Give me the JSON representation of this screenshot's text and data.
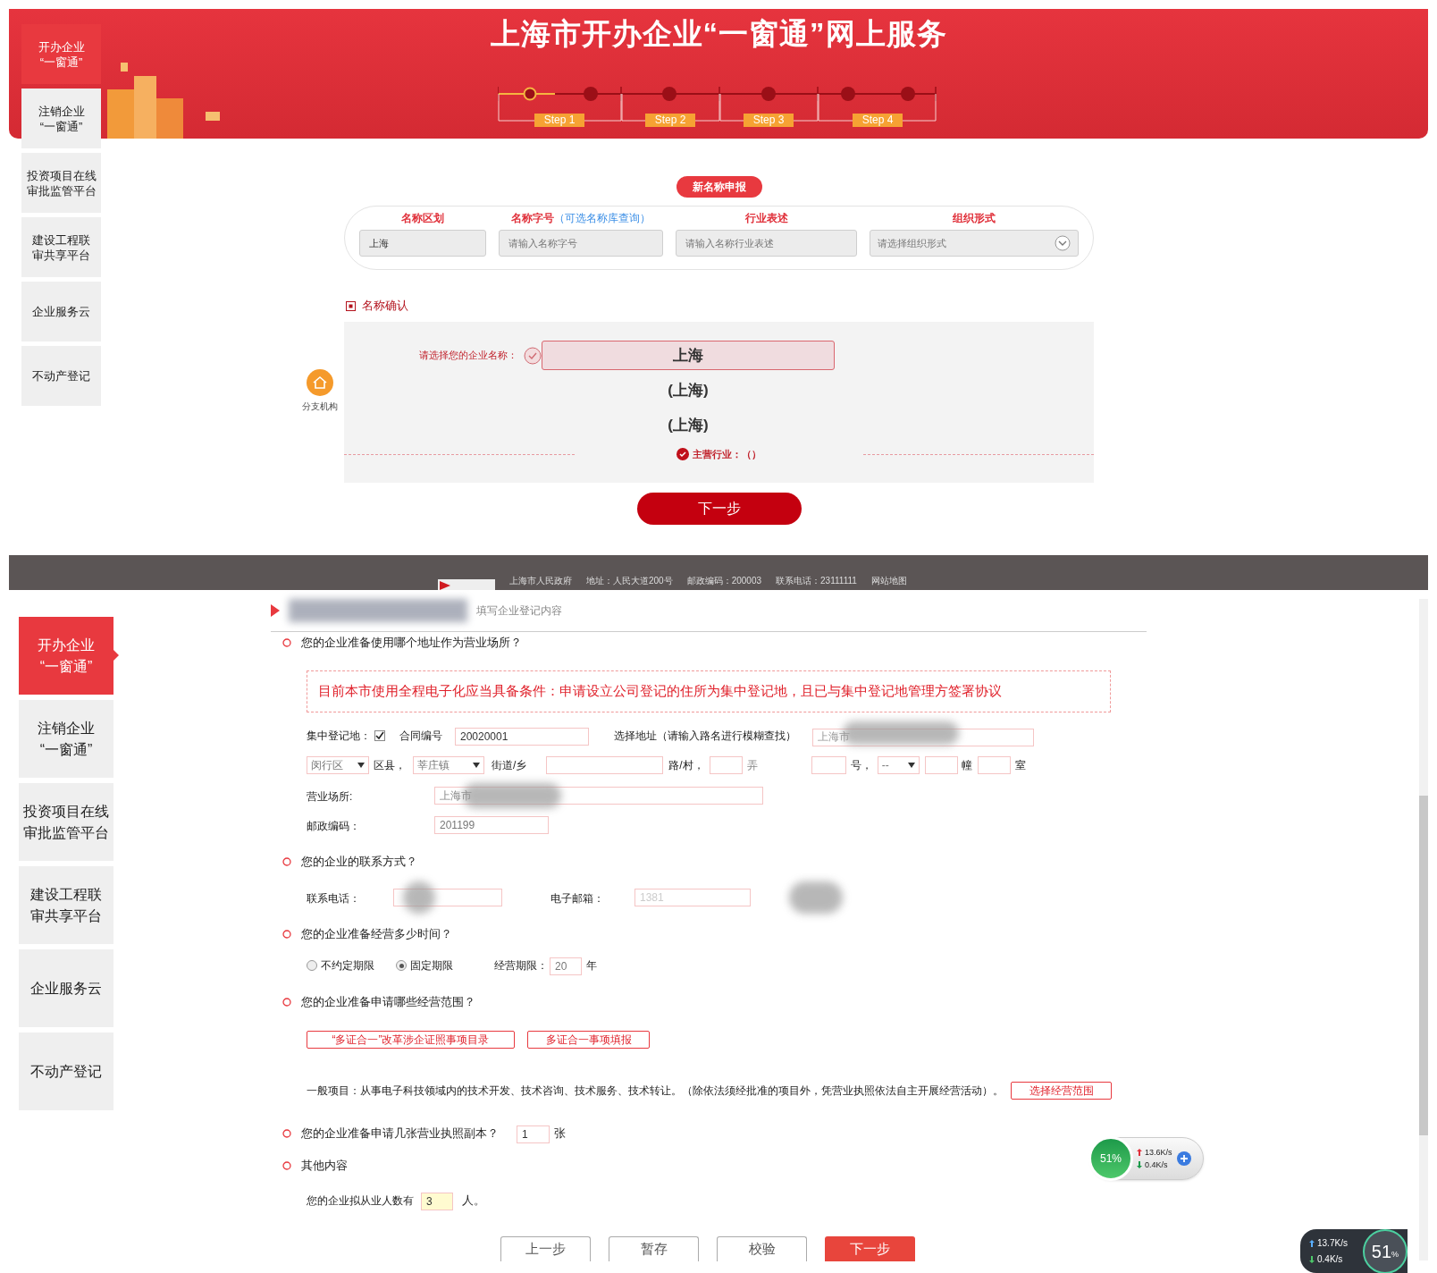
{
  "top": {
    "sidebar": [
      {
        "lines": [
          "开办企业",
          "“一窗通”"
        ],
        "selected": true
      },
      {
        "lines": [
          "注销企业",
          "“一窗通”"
        ],
        "selected": false
      },
      {
        "lines": [
          "投资项目在线",
          "审批监管平台"
        ],
        "selected": false
      },
      {
        "lines": [
          "建设工程联",
          "审共享平台"
        ],
        "selected": false
      },
      {
        "lines": [
          "企业服务云"
        ],
        "selected": false
      },
      {
        "lines": [
          "不动产登记"
        ],
        "selected": false
      }
    ],
    "title": "上海市开办企业“一窗通”网上服务",
    "dots": [
      {
        "current": true
      },
      {
        "current": false
      },
      {
        "current": false
      },
      {
        "current": false
      },
      {
        "current": false
      },
      {
        "current": false
      }
    ],
    "steps": [
      {
        "label": "Step 1"
      },
      {
        "label": "Step 2"
      },
      {
        "label": "Step 3"
      },
      {
        "label": "Step 4"
      }
    ],
    "pill": "新名称申报",
    "name_fields": [
      {
        "kind": "text",
        "label": "名称区划",
        "value": "上海"
      },
      {
        "kind": "text",
        "label": "名称字号",
        "link": "（可选名称库查询）",
        "placeholder": "请输入名称字号"
      },
      {
        "kind": "text",
        "label": "行业表述",
        "placeholder": "请输入名称行业表述"
      },
      {
        "kind": "select",
        "label": "组织形式",
        "placeholder": "请选择组织形式"
      }
    ],
    "section_title": "名称确认",
    "branch": "分支机构",
    "choose_label": "请选择您的企业名称：",
    "names": [
      {
        "text": "上海",
        "selected": true
      },
      {
        "text": "(上海)",
        "selected": false
      },
      {
        "text": "(上海)",
        "selected": false
      }
    ],
    "industry": "主营行业：（）",
    "next": "下一步",
    "footer": [
      "上海市人民政府",
      "地址：人民大道200号",
      "邮政编码：200003",
      "联系电话：23111111",
      "网站地图"
    ]
  },
  "bottom": {
    "sidebar": [
      {
        "lines": [
          "开办企业",
          "“一窗通”"
        ],
        "selected": true
      },
      {
        "lines": [
          "注销企业",
          "“一窗通”"
        ],
        "selected": false
      },
      {
        "lines": [
          "投资项目在线",
          "审批监管平台"
        ],
        "selected": false
      },
      {
        "lines": [
          "建设工程联",
          "审共享平台"
        ],
        "selected": false
      },
      {
        "lines": [
          "企业服务云"
        ],
        "selected": false
      },
      {
        "lines": [
          "不动产登记"
        ],
        "selected": false
      }
    ],
    "breadcrumb": "填写企业登记内容",
    "q_address": "您的企业准备使用哪个地址作为营业场所？",
    "notice": "目前本市使用全程电子化应当具备条件：申请设立公司登记的住所为集中登记地，且已与集中登记地管理方签署协议",
    "central_label": "集中登记地：",
    "central_checked": true,
    "contract_label": "合同编号",
    "contract_value": "20020001",
    "address_search_label": "选择地址（请输入路名进行模糊查找）",
    "address_search_value": "上海市",
    "district": "闵行区",
    "district_unit": "区县，",
    "town": "莘庄镇",
    "town_unit": "街道/乡",
    "road_unit": "路/村，",
    "lane_unit": "弄",
    "number_unit": "号，",
    "number_select": "--",
    "building_unit": "幢",
    "room_unit": "室",
    "place_label": "营业场所:",
    "place_value": "上海市",
    "postal_label": "邮政编码：",
    "postal_value": "201199",
    "q_contact": "您的企业的联系方式？",
    "phone_label": "联系电话：",
    "email_label": "电子邮箱：",
    "email_value": "1381",
    "q_term": "您的企业准备经营多少时间？",
    "term_options": [
      {
        "label": "不约定期限",
        "selected": false
      },
      {
        "label": "固定期限",
        "selected": true
      }
    ],
    "term_label": "经营期限：",
    "term_value": "20",
    "term_unit": "年",
    "q_scope": "您的企业准备申请哪些经营范围？",
    "scope_buttons": [
      "“多证合一”改革涉企证照事项目录",
      "多证合一事项填报"
    ],
    "scope_text": "一般项目：从事电子科技领域内的技术开发、技术咨询、技术服务、技术转让。（除依法须经批准的项目外，凭营业执照依法自主开展经营活动）。",
    "scope_select": "选择经营范围",
    "q_copies": "您的企业准备申请几张营业执照副本？",
    "copies_value": "1",
    "copies_unit": "张",
    "q_other": "其他内容",
    "staff_label": "您的企业拟从业人数有",
    "staff_value": "3",
    "staff_unit": "人。",
    "actions": [
      {
        "label": "上一步",
        "kind": "secondary"
      },
      {
        "label": "暂存",
        "kind": "secondary"
      },
      {
        "label": "校验",
        "kind": "secondary"
      },
      {
        "label": "下一步",
        "kind": "primary"
      }
    ],
    "net_widget": {
      "percent": "51%",
      "up": "13.6K/s",
      "down": "0.4K/s"
    },
    "net_widget_dark": {
      "up": "13.7K/s",
      "down": "0.4K/s",
      "percent": "51",
      "percent_sign": "%"
    }
  }
}
